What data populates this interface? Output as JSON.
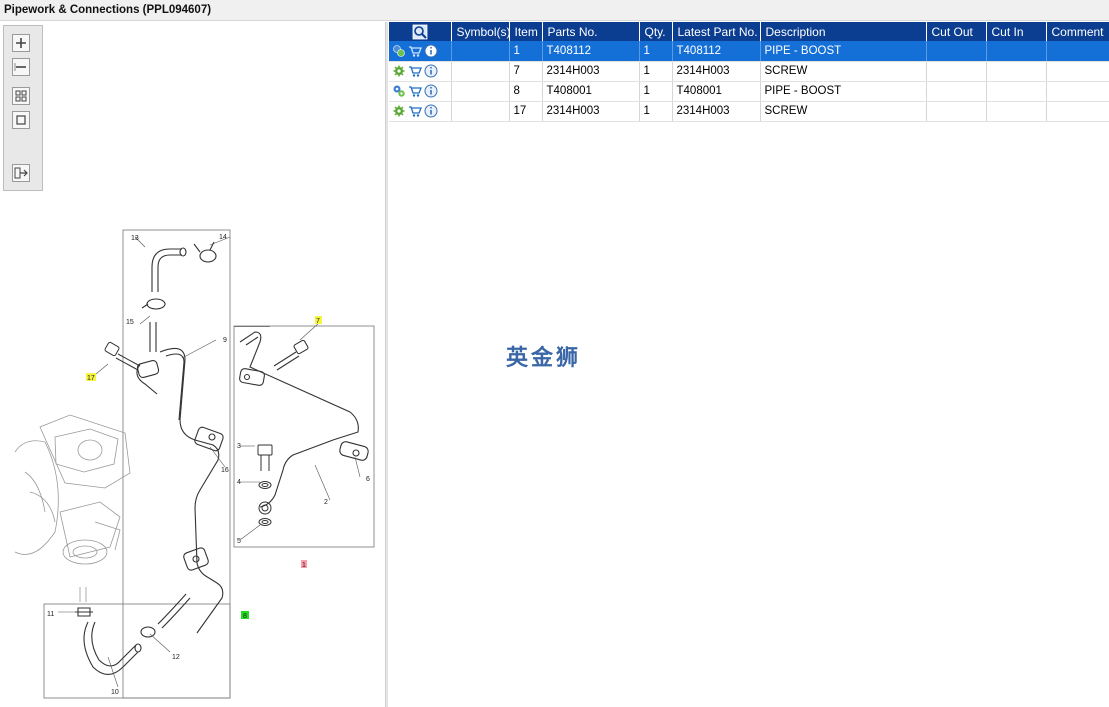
{
  "window": {
    "title": "Pipework & Connections (PPL094607)"
  },
  "toolbar": {
    "buttons": [
      {
        "name": "zoom-in",
        "icon": "plus-icon"
      },
      {
        "name": "zoom-out",
        "icon": "minus-icon"
      },
      {
        "name": "fit-all",
        "icon": "grid-icon"
      },
      {
        "name": "actual-size",
        "icon": "square-icon"
      },
      {
        "name": "export",
        "icon": "export-arrow-icon"
      }
    ]
  },
  "diagram": {
    "callouts": [
      "13",
      "14",
      "15",
      "9",
      "7",
      "17",
      "3",
      "4",
      "5",
      "6",
      "2",
      "16",
      "11",
      "12",
      "10",
      "8",
      "1"
    ],
    "highlight_colors": {
      "yellow": "#f5f542",
      "green": "#22dd22",
      "red": "#ff9aa8"
    }
  },
  "table": {
    "columns": [
      "Symbol(s)",
      "Item",
      "Parts No.",
      "Qty.",
      "Latest Part No.",
      "Description",
      "Cut Out",
      "Cut In",
      "Comment"
    ],
    "rows": [
      {
        "item": "1",
        "part_no": "T408112",
        "qty": "1",
        "latest": "T408112",
        "desc": "PIPE - BOOST",
        "cut_out": "",
        "cut_in": "",
        "comment": "",
        "selected": true
      },
      {
        "item": "7",
        "part_no": "2314H003",
        "qty": "1",
        "latest": "2314H003",
        "desc": "SCREW",
        "cut_out": "",
        "cut_in": "",
        "comment": "",
        "selected": false
      },
      {
        "item": "8",
        "part_no": "T408001",
        "qty": "1",
        "latest": "T408001",
        "desc": "PIPE - BOOST",
        "cut_out": "",
        "cut_in": "",
        "comment": "",
        "selected": false
      },
      {
        "item": "17",
        "part_no": "2314H003",
        "qty": "1",
        "latest": "2314H003",
        "desc": "SCREW",
        "cut_out": "",
        "cut_in": "",
        "comment": "",
        "selected": false
      }
    ]
  },
  "watermark": {
    "text": "英金狮"
  },
  "colors": {
    "header_bg": "#0b3d91",
    "selected_row": "#1470d7"
  }
}
